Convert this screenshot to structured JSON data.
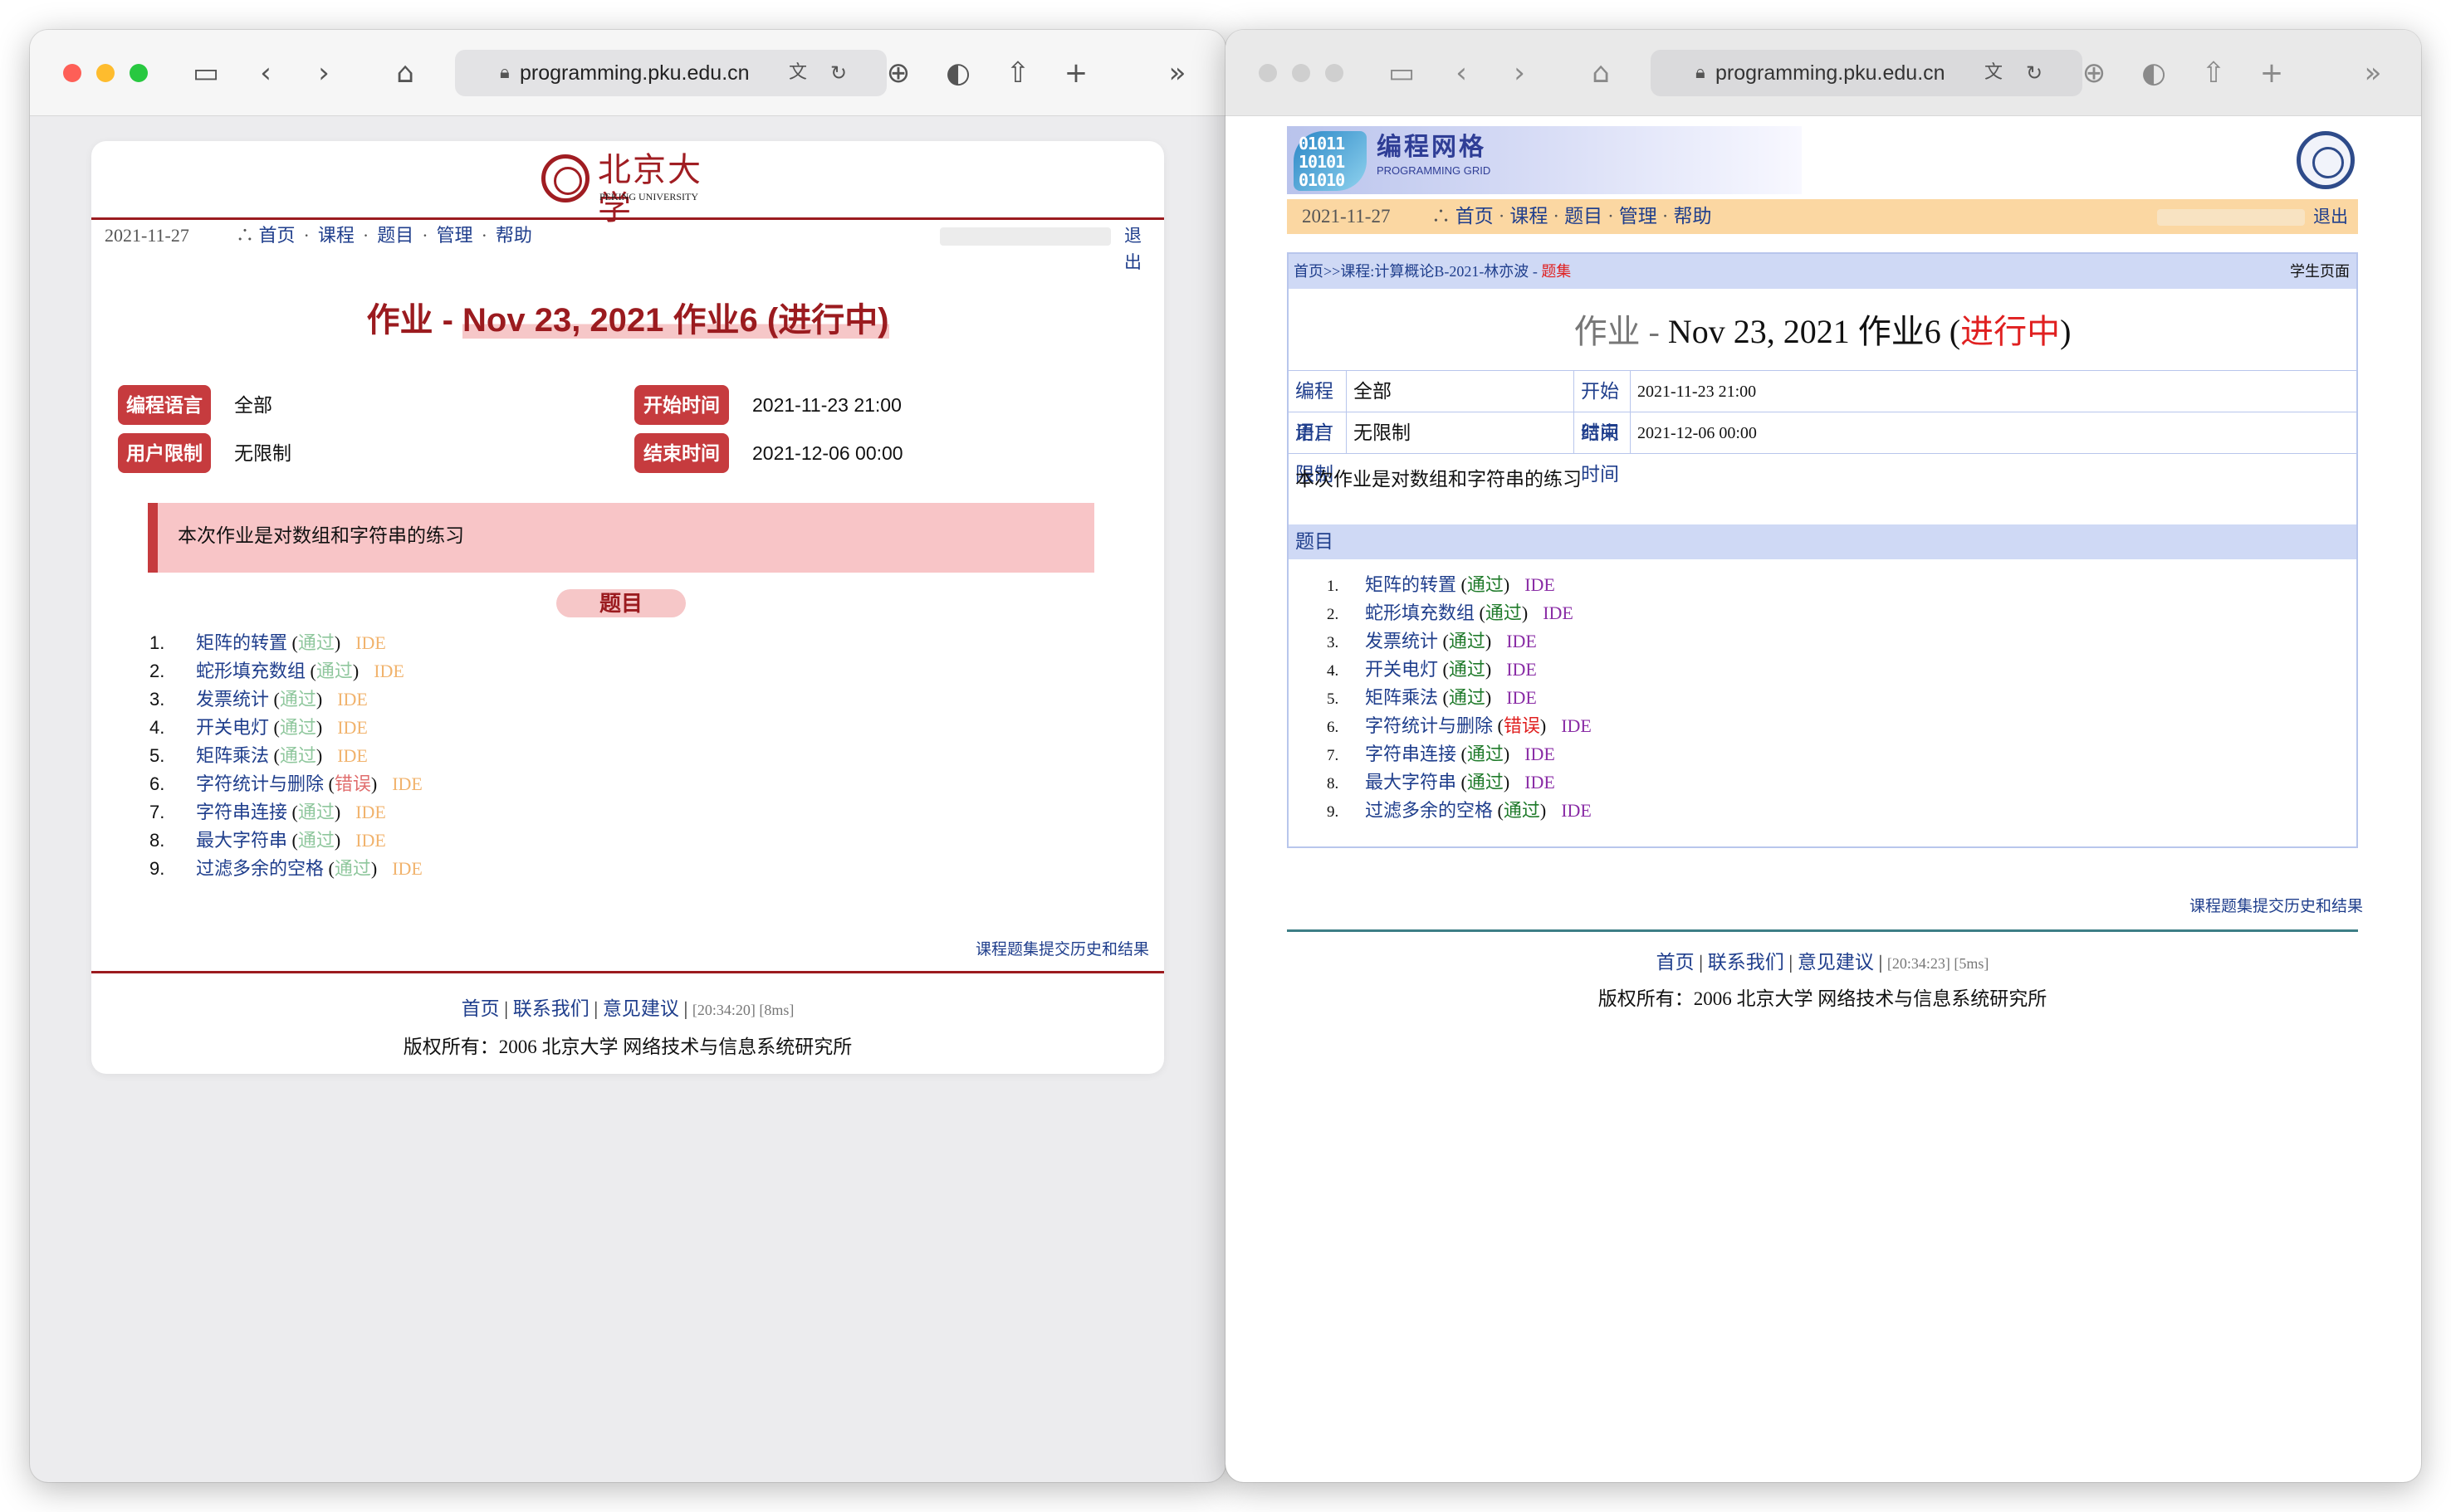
{
  "browser": {
    "url": "programming.pku.edu.cn"
  },
  "win1": {
    "logo": {
      "name_cn": "北京大学",
      "name_en": "PEKING UNIVERSITY"
    },
    "nav": {
      "date": "2021-11-27",
      "prefix": "∴",
      "links": [
        "首页",
        "课程",
        "题目",
        "管理",
        "帮助"
      ],
      "logout": "退出"
    },
    "title": {
      "prefix": "作业 - ",
      "main": "Nov 23, 2021 作业6 (进行中)"
    },
    "info": {
      "lang_label": "编程语言",
      "lang_value": "全部",
      "limit_label": "用户限制",
      "limit_value": "无限制",
      "start_label": "开始时间",
      "start_value": "2021-11-23 21:00",
      "end_label": "结束时间",
      "end_value": "2021-12-06 00:00"
    },
    "description": "本次作业是对数组和字符串的练习",
    "problems_header": "题目",
    "problems": [
      {
        "num": "1.",
        "name": "矩阵的转置",
        "status": "通过",
        "ide": "IDE"
      },
      {
        "num": "2.",
        "name": "蛇形填充数组",
        "status": "通过",
        "ide": "IDE"
      },
      {
        "num": "3.",
        "name": "发票统计",
        "status": "通过",
        "ide": "IDE"
      },
      {
        "num": "4.",
        "name": "开关电灯",
        "status": "通过",
        "ide": "IDE"
      },
      {
        "num": "5.",
        "name": "矩阵乘法",
        "status": "通过",
        "ide": "IDE"
      },
      {
        "num": "6.",
        "name": "字符统计与删除",
        "status": "错误",
        "ide": "IDE"
      },
      {
        "num": "7.",
        "name": "字符串连接",
        "status": "通过",
        "ide": "IDE"
      },
      {
        "num": "8.",
        "name": "最大字符串",
        "status": "通过",
        "ide": "IDE"
      },
      {
        "num": "9.",
        "name": "过滤多余的空格",
        "status": "通过",
        "ide": "IDE"
      }
    ],
    "history_link": "课程题集提交历史和结果",
    "footer": {
      "home": "首页",
      "contact": "联系我们",
      "feedback": "意见建议",
      "timing": "[20:34:20] [8ms]",
      "copyright": "版权所有：2006 北京大学 网络技术与信息系统研究所"
    }
  },
  "win2": {
    "banner": {
      "graphic_text": "01011\n10101\n01010",
      "name_cn": "编程网格",
      "name_en": "PROGRAMMING GRID"
    },
    "nav": {
      "date": "2021-11-27",
      "prefix": "∴",
      "links": [
        "首页",
        "课程",
        "题目",
        "管理",
        "帮助"
      ],
      "logout": "退出"
    },
    "breadcrumb": {
      "home": "首页>>",
      "course": "课程:计算概论B-2021-林亦波",
      "sep": " - ",
      "current": "题集",
      "student_page": "学生页面"
    },
    "title": {
      "prefix": "作业 - ",
      "main": "Nov 23, 2021 作业6 (",
      "status": "进行中",
      "suffix": ")"
    },
    "info": {
      "lang_label": "编程语言",
      "lang_value": "全部",
      "limit_label": "用户限制",
      "limit_value": "无限制",
      "start_label": "开始时间",
      "start_value": "2021-11-23 21:00",
      "end_label": "结束时间",
      "end_value": "2021-12-06 00:00"
    },
    "description": "本次作业是对数组和字符串的练习",
    "problems_header": "题目",
    "problems": [
      {
        "num": "1.",
        "name": "矩阵的转置",
        "status": "通过",
        "ide": "IDE"
      },
      {
        "num": "2.",
        "name": "蛇形填充数组",
        "status": "通过",
        "ide": "IDE"
      },
      {
        "num": "3.",
        "name": "发票统计",
        "status": "通过",
        "ide": "IDE"
      },
      {
        "num": "4.",
        "name": "开关电灯",
        "status": "通过",
        "ide": "IDE"
      },
      {
        "num": "5.",
        "name": "矩阵乘法",
        "status": "通过",
        "ide": "IDE"
      },
      {
        "num": "6.",
        "name": "字符统计与删除",
        "status": "错误",
        "ide": "IDE"
      },
      {
        "num": "7.",
        "name": "字符串连接",
        "status": "通过",
        "ide": "IDE"
      },
      {
        "num": "8.",
        "name": "最大字符串",
        "status": "通过",
        "ide": "IDE"
      },
      {
        "num": "9.",
        "name": "过滤多余的空格",
        "status": "通过",
        "ide": "IDE"
      }
    ],
    "history_link": "课程题集提交历史和结果",
    "footer": {
      "home": "首页",
      "contact": "联系我们",
      "feedback": "意见建议",
      "timing": "[20:34:23] [5ms]",
      "copyright": "版权所有：2006 北京大学 网络技术与信息系统研究所"
    }
  },
  "colors": {
    "pku_red": "#9b1b1f",
    "badge_red": "#c63b3e",
    "link_blue": "#1f3e8c",
    "pass_green_light": "#8fc79d",
    "pass_green_dark": "#1f7a2a",
    "fail_red": "#e02020",
    "ide_orange": "#f1b36d",
    "ide_purple": "#8a2da6",
    "nav_orange": "#fbd7a2",
    "panel_blue": "#cfd9f5"
  },
  "icons": [
    "sidebar-icon",
    "back-icon",
    "forward-icon",
    "home-icon",
    "lock-icon",
    "translate-icon",
    "reload-icon",
    "download-icon",
    "shield-icon",
    "share-icon",
    "new-tab-icon",
    "overflow-icon"
  ]
}
